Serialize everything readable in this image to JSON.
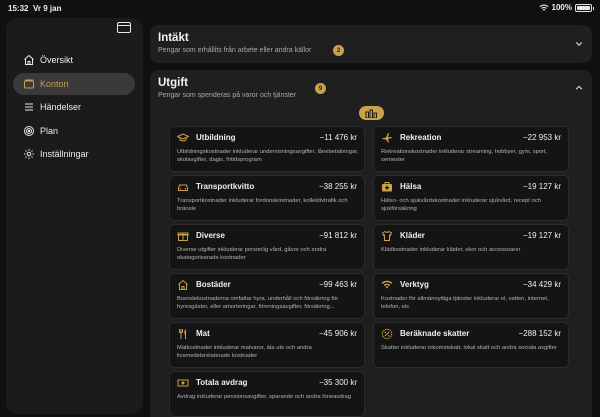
{
  "status": {
    "time": "15:32",
    "date": "Vr 9 jan",
    "battery": "100%"
  },
  "sidebar": {
    "items": [
      {
        "label": "Översikt",
        "icon": "house-icon",
        "active": false
      },
      {
        "label": "Konton",
        "icon": "wallet-icon",
        "active": true
      },
      {
        "label": "Händelser",
        "icon": "list-icon",
        "active": false
      },
      {
        "label": "Plan",
        "icon": "target-icon",
        "active": false
      },
      {
        "label": "Inställningar",
        "icon": "gear-icon",
        "active": false
      }
    ]
  },
  "income": {
    "title": "Intäkt",
    "subtitle": "Pengar som erhållits från arbete eller andra källor",
    "count": "2"
  },
  "expense": {
    "title": "Utgift",
    "subtitle": "Pengar som spenderas på varor och tjänster",
    "count": "9",
    "cards": [
      {
        "name": "Utbildning",
        "amount": "−11 476 kr",
        "icon": "graduation-cap-icon",
        "desc": "Utbildningskostnader inkluderar undervisningsavgifter, lånebetalningar, skolavgifter, dagis, fritidsprogram"
      },
      {
        "name": "Rekreation",
        "amount": "−22 953 kr",
        "icon": "airplane-icon",
        "desc": "Rekreationskostnader inkluderar streaming, hobbyer, gym, sport, semester"
      },
      {
        "name": "Transportkvitto",
        "amount": "−38 255 kr",
        "icon": "car-icon",
        "desc": "Transportkostnader inkluderar fordonskostnader, kollektivtrafik och bränsle"
      },
      {
        "name": "Hälsa",
        "amount": "−19 127 kr",
        "icon": "medical-kit-icon",
        "desc": "Hälso- och sjukvårdskostnader inkluderar sjukvård, recept och sjukförsäkring"
      },
      {
        "name": "Diverse",
        "amount": "−91 812 kr",
        "icon": "gift-icon",
        "desc": "Diverse utgifter inkluderar personlig vård, gåvor och andra okategoriserade kostnader"
      },
      {
        "name": "Kläder",
        "amount": "−19 127 kr",
        "icon": "shirt-icon",
        "desc": "Klädkostnader inkluderar kläder, skor och accessoarer"
      },
      {
        "name": "Bostäder",
        "amount": "−99 463 kr",
        "icon": "house-icon",
        "desc": "Boendekostnaderna omfattar hyra, underhåll och försäkring för hyresgäster, eller amorteringar, föreningsavgifter, försäkring..."
      },
      {
        "name": "Verktyg",
        "amount": "−34 429 kr",
        "icon": "wifi-icon",
        "desc": "Kostnader för allmännyttiga tjänster inkluderar el, vatten, internet, telefon, etc"
      },
      {
        "name": "Mat",
        "amount": "−45 906 kr",
        "icon": "fork-knife-icon",
        "desc": "Matkostnader inkluderar matvaror, äta ute och andra livsmedelsrelaterade kostnader"
      },
      {
        "name": "Beräknade skatter",
        "amount": "−288 152 kr",
        "icon": "percent-badge-icon",
        "desc": "Skatter inkluderar inkomstskatt, lokal skatt och andra sociala avgifter"
      },
      {
        "name": "Totala avdrag",
        "amount": "−35 300 kr",
        "icon": "banknote-icon",
        "desc": "Avdrag inkluderar pensionsavgifter, sparande och andra löneavdrag"
      }
    ]
  },
  "colors": {
    "accent": "#c9a14a",
    "background": "#101010",
    "panel": "#1f1f1f",
    "card": "#141414"
  }
}
